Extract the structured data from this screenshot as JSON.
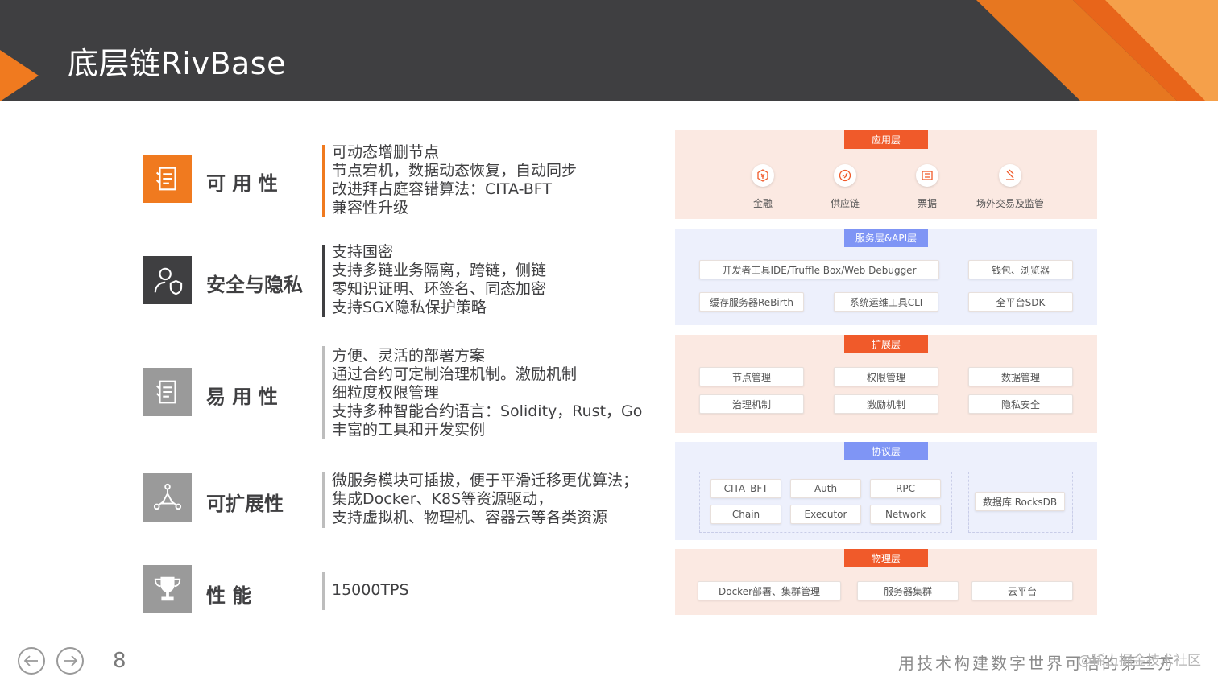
{
  "title": "底层链RivBase",
  "features": [
    {
      "name": "可 用 性",
      "icon": "checklist-icon",
      "lines": [
        "可动态增删节点",
        "节点宕机，数据动态恢复，自动同步",
        "改进拜占庭容错算法：CITA-BFT",
        "兼容性升级"
      ]
    },
    {
      "name": "安全与隐私",
      "icon": "user-shield-icon",
      "lines": [
        "支持国密",
        "支持多链业务隔离，跨链，侧链",
        "零知识证明、环签名、同态加密",
        "支持SGX隐私保护策略"
      ]
    },
    {
      "name": "易 用 性",
      "icon": "checklist-icon",
      "lines": [
        "方便、灵活的部署方案",
        "通过合约可定制治理机制。激励机制",
        "细粒度权限管理",
        "支持多种智能合约语言：Solidity，Rust，Go",
        "丰富的工具和开发实例"
      ]
    },
    {
      "name": "可扩展性",
      "icon": "network-triangle-icon",
      "lines": [
        "微服务模块可插拔，便于平滑迁移更优算法；",
        "集成Docker、K8S等资源驱动，",
        "支持虚拟机、物理机、容器云等各类资源"
      ]
    },
    {
      "name": "性      能",
      "icon": "trophy-icon",
      "lines": [
        "15000TPS"
      ]
    }
  ],
  "colors": {
    "header_bg": "#3f3f41",
    "accent_orange": "#f07a1f",
    "layer_orange_label": "#f05a2a",
    "layer_blue_label": "#7f95f5",
    "layer_orange_bg": "#fbe9e2",
    "layer_blue_bg": "#edf0fc"
  },
  "architecture": {
    "app_layer": {
      "label": "应用层",
      "items": [
        "金融",
        "供应链",
        "票据",
        "场外交易及监管"
      ]
    },
    "service_layer": {
      "label": "服务层&API层",
      "items": [
        "开发者工具IDE/Truffle Box/Web Debugger",
        "钱包、浏览器",
        "缓存服务器ReBirth",
        "系统运维工具CLI",
        "全平台SDK"
      ]
    },
    "extension_layer": {
      "label": "扩展层",
      "items": [
        "节点管理",
        "权限管理",
        "数据管理",
        "治理机制",
        "激励机制",
        "隐私安全"
      ]
    },
    "protocol_layer": {
      "label": "协议层",
      "items": [
        "CITA–BFT",
        "Auth",
        "RPC",
        "Chain",
        "Executor",
        "Network",
        "数据库 RocksDB"
      ]
    },
    "physical_layer": {
      "label": "物理层",
      "items": [
        "Docker部署、集群管理",
        "服务器集群",
        "云平台"
      ]
    }
  },
  "footer": {
    "page_number": "8",
    "slogan": "用技术构建数字世界可信的第三方",
    "watermark": "@稀土掘金技术社区"
  }
}
